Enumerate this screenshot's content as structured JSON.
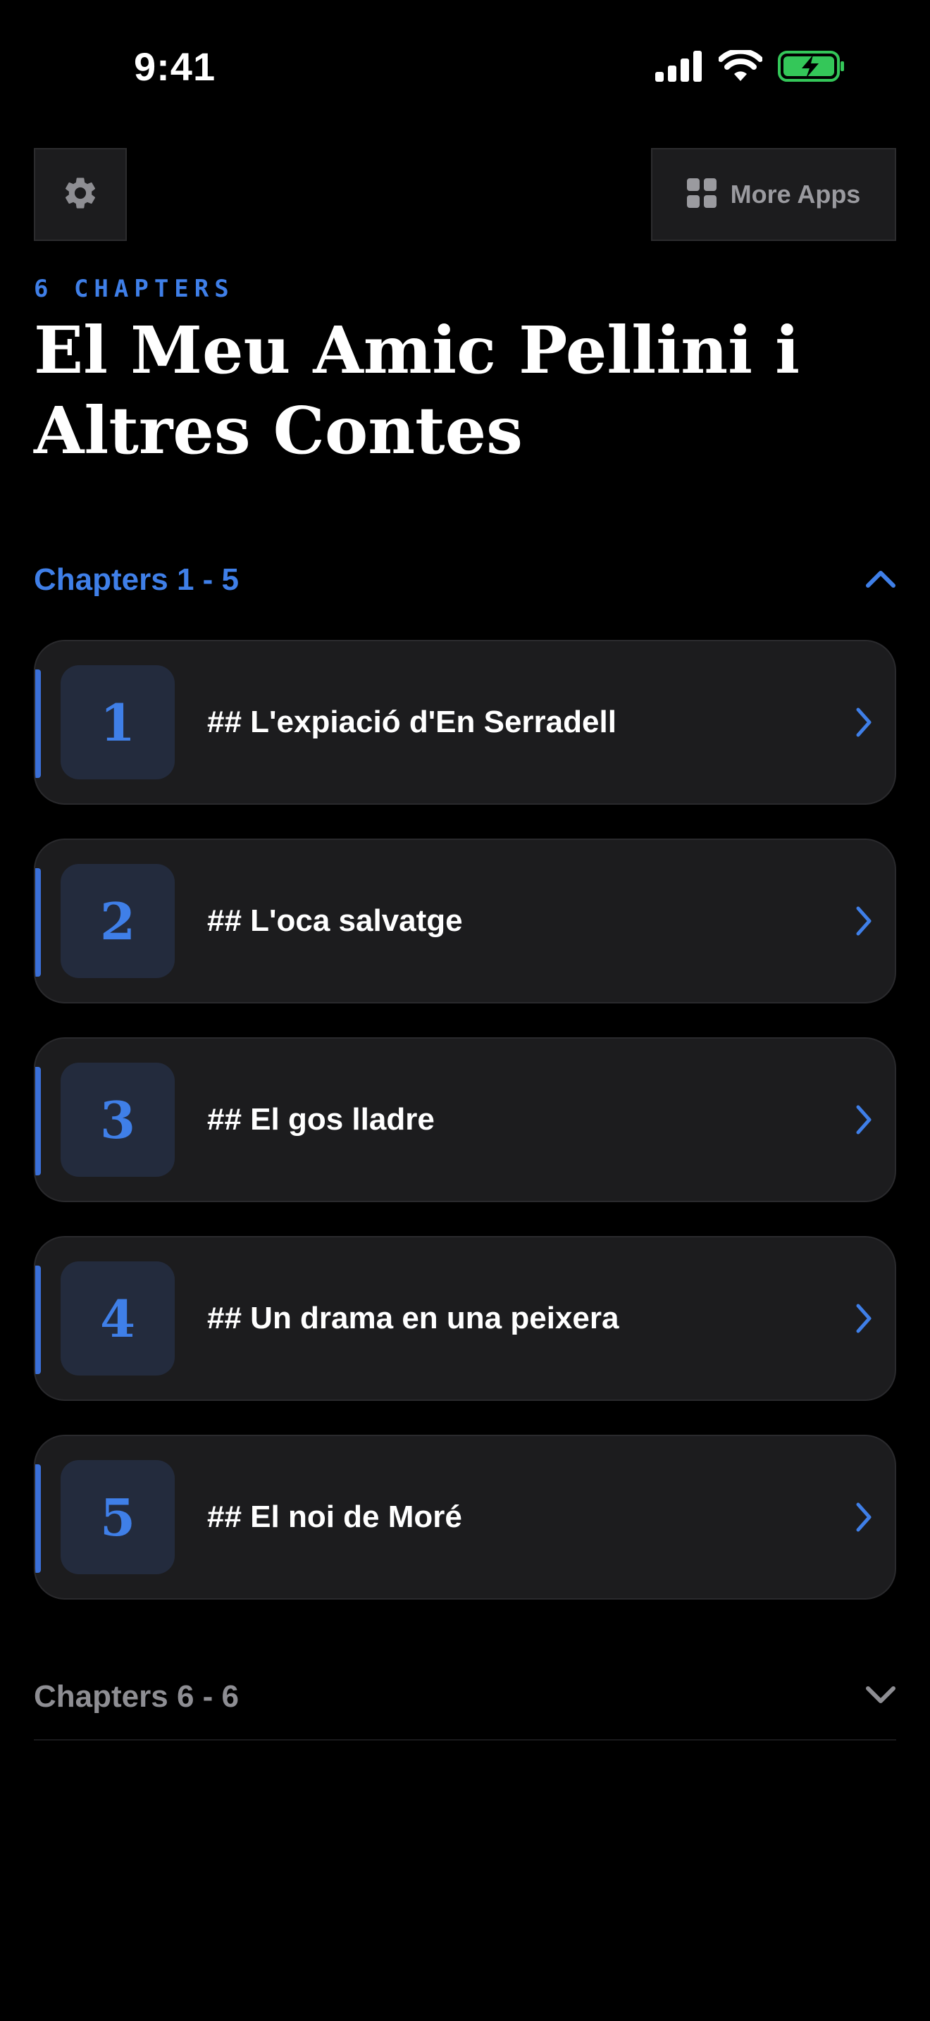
{
  "status_bar": {
    "time": "9:41"
  },
  "toolbar": {
    "settings_icon": "gear-icon",
    "more_apps_label": "More Apps",
    "more_apps_icon": "grid-icon"
  },
  "header": {
    "chapter_count": "6 CHAPTERS",
    "title": "El Meu Amic Pellini i Altres Contes"
  },
  "sections": [
    {
      "label": "Chapters 1 - 5",
      "expanded": true,
      "chapters": [
        {
          "number": "1",
          "title": "## L'expiació d'En Serradell"
        },
        {
          "number": "2",
          "title": "## L'oca salvatge"
        },
        {
          "number": "3",
          "title": "## El gos lladre"
        },
        {
          "number": "4",
          "title": "## Un drama en una peixera"
        },
        {
          "number": "5",
          "title": "## El noi de Moré"
        }
      ]
    },
    {
      "label": "Chapters 6 - 6",
      "expanded": false,
      "chapters": []
    }
  ],
  "colors": {
    "accent": "#3f7fe8",
    "card_bg": "#1c1c1e",
    "number_bg": "#232b3d",
    "muted": "#8e8e93",
    "battery": "#34c759"
  }
}
